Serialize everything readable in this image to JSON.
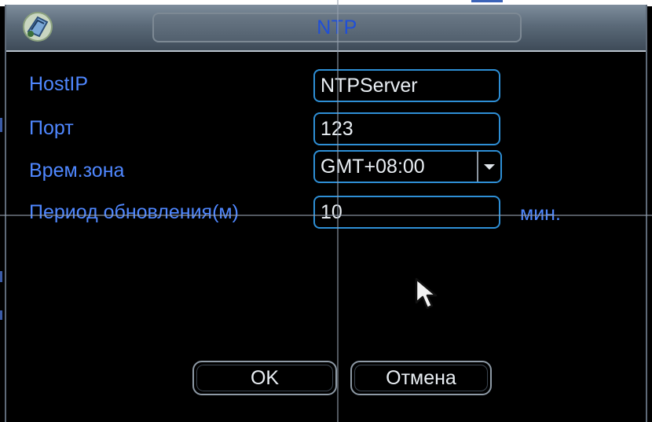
{
  "dialog": {
    "title": "NTP",
    "logo_icon": "camera-logo-icon"
  },
  "form": {
    "host_ip": {
      "label": "HostIP",
      "value": "NTPServer"
    },
    "port": {
      "label": "Порт",
      "value": "123"
    },
    "timezone": {
      "label": "Врем.зона",
      "value": "GMT+08:00"
    },
    "update_period": {
      "label": "Период обновления(м)",
      "value": "10",
      "unit": "мин."
    }
  },
  "buttons": {
    "ok_label": "OK",
    "cancel_label": "Отмена"
  },
  "colors": {
    "label_blue": "#4f87ff",
    "title_blue": "#1f4fd8",
    "field_border": "#2e8fd6",
    "background": "#000000"
  }
}
